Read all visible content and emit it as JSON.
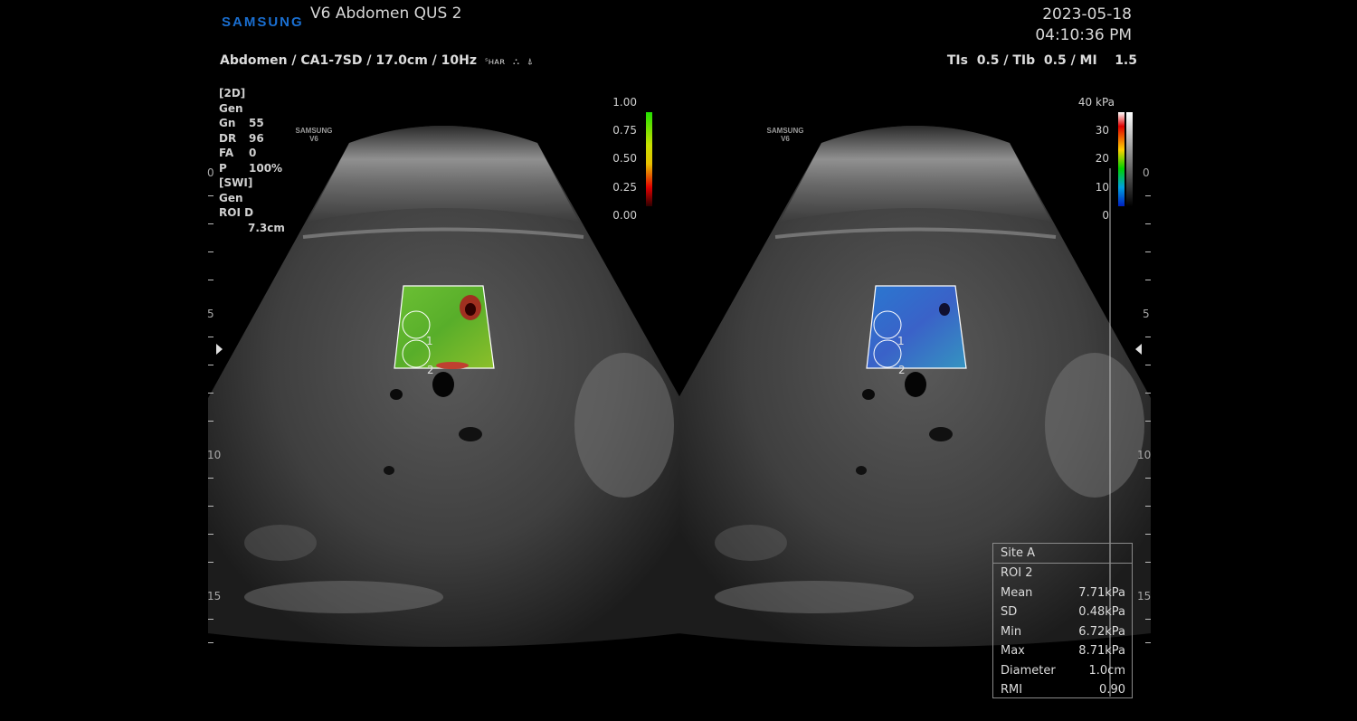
{
  "header": {
    "brand": "SAMSUNG",
    "preset_title": "V6 Abdomen QUS 2",
    "date": "2023-05-18",
    "time": "04:10:36 PM",
    "probe_line": "Abdomen / CA1-7SD / 17.0cm / 10Hz",
    "acoustic_indices": "TIs  0.5 / TIb  0.5 / MI    1.5"
  },
  "params": {
    "mode_2d": "[2D]",
    "gen1": "Gen",
    "gn_label": "Gn",
    "gn_value": "55",
    "dr_label": "DR",
    "dr_value": "96",
    "fa_label": "FA",
    "fa_value": "0",
    "p_label": "P",
    "p_value": "100%",
    "mode_swi": "[SWI]",
    "gen2": "Gen",
    "roid_label": "ROI D",
    "roid_value": "7.3cm"
  },
  "mini_logo": {
    "line1": "SAMSUNG",
    "line2": "V6"
  },
  "left_scale": {
    "labels": [
      "1.00",
      "0.75",
      "0.50",
      "0.25",
      "0.00"
    ],
    "colors": [
      "#22e000",
      "#c8e000",
      "#e8c000",
      "#e00000",
      "#300000"
    ]
  },
  "right_scale": {
    "labels": [
      "40 kPa",
      "30",
      "20",
      "10",
      "0"
    ],
    "colors": [
      "#ffffff",
      "#e00000",
      "#ffd000",
      "#00d000",
      "#0020c0"
    ]
  },
  "depth_labels": {
    "d0": "0",
    "d5": "5",
    "d10": "10",
    "d15": "15"
  },
  "roi_labels": {
    "roi1": "1",
    "roi2": "2"
  },
  "colors": {
    "elasticity_left": "#5ab02c",
    "elasticity_right": "#2e6fc4",
    "brand": "#1a6fd1"
  },
  "stats": {
    "site": "Site A",
    "roi": "ROI 2",
    "rows": [
      {
        "label": "Mean",
        "value": "7.71kPa"
      },
      {
        "label": "SD",
        "value": "0.48kPa"
      },
      {
        "label": "Min",
        "value": "6.72kPa"
      },
      {
        "label": "Max",
        "value": "8.71kPa"
      },
      {
        "label": "Diameter",
        "value": "1.0cm"
      },
      {
        "label": "RMI",
        "value": "0.90"
      }
    ]
  }
}
